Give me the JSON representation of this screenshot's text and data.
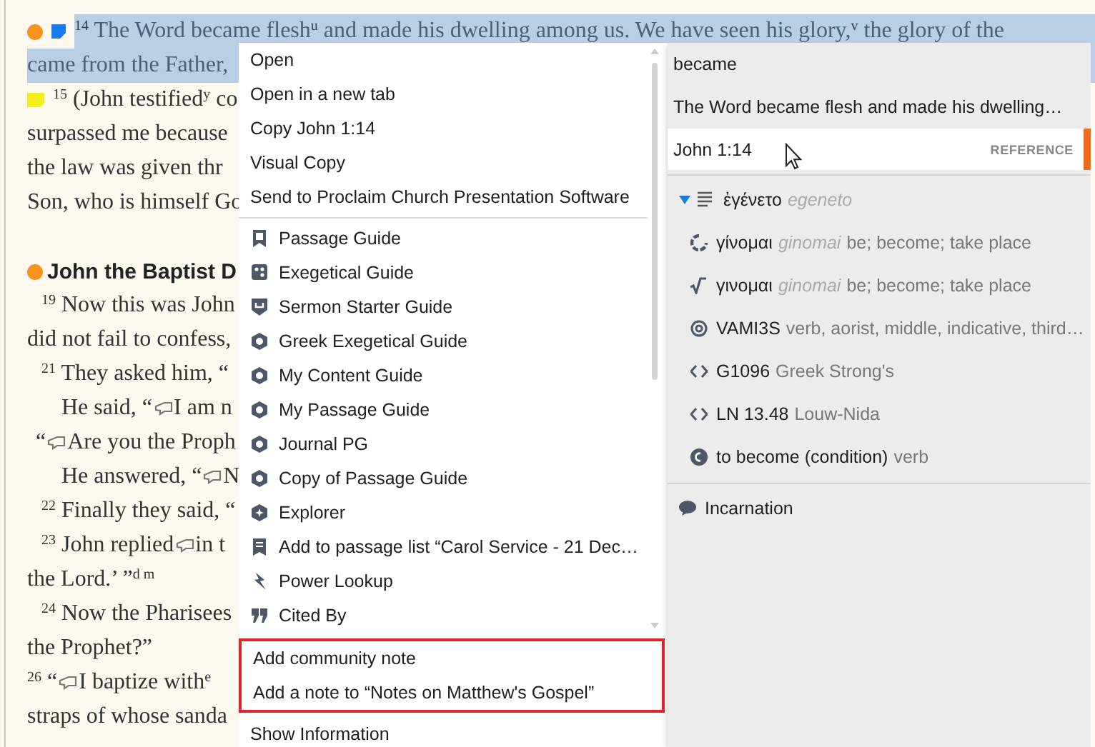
{
  "passage": {
    "lines": [
      {
        "kind": "flush",
        "highlighted": true,
        "bookmarked": true,
        "noted": true,
        "marked": false,
        "parts": [
          {
            "kind": "text",
            "text": "$^{14}$ The Word became flesh$^{u}$ and made his dwelling among us. We have seen his glory,$^{v}$ the glory of the"
          }
        ]
      },
      {
        "kind": "flush",
        "highlighted": true,
        "bookmarked": false,
        "noted": false,
        "marked": false,
        "parts": [
          {
            "kind": "text",
            "text": "came from the Father,"
          }
        ]
      },
      {
        "kind": "flush",
        "highlighted": false,
        "bookmarked": false,
        "noted": false,
        "marked": true,
        "parts": [
          {
            "kind": "text",
            "text": "$^{15}$ (John testified$^{y}$ co"
          }
        ]
      },
      {
        "kind": "flush",
        "highlighted": false,
        "bookmarked": false,
        "noted": false,
        "marked": false,
        "parts": [
          {
            "kind": "text",
            "text": "surpassed me because"
          }
        ]
      },
      {
        "kind": "flush",
        "highlighted": false,
        "bookmarked": false,
        "noted": false,
        "marked": false,
        "parts": [
          {
            "kind": "text",
            "text": "the law was given thr"
          }
        ]
      },
      {
        "kind": "flush",
        "highlighted": false,
        "bookmarked": false,
        "noted": false,
        "marked": false,
        "parts": [
          {
            "kind": "text",
            "text": "Son, who is himself Go"
          }
        ]
      },
      {
        "kind": "heading",
        "highlighted": false,
        "bookmarked": true,
        "noted": false,
        "marked": false,
        "parts": [
          {
            "kind": "text",
            "text": "John the Baptist D"
          }
        ]
      },
      {
        "kind": "indent",
        "highlighted": false,
        "bookmarked": false,
        "noted": false,
        "marked": false,
        "parts": [
          {
            "kind": "text",
            "text": "$^{19}$ Now this was John"
          }
        ]
      },
      {
        "kind": "flush",
        "highlighted": false,
        "bookmarked": false,
        "noted": false,
        "marked": false,
        "parts": [
          {
            "kind": "text",
            "text": "did not fail to confess,"
          }
        ]
      },
      {
        "kind": "indent",
        "highlighted": false,
        "bookmarked": false,
        "noted": false,
        "marked": false,
        "parts": [
          {
            "kind": "text",
            "text": "$^{21}$ They asked him, “"
          }
        ]
      },
      {
        "kind": "deep",
        "highlighted": false,
        "bookmarked": false,
        "noted": false,
        "marked": false,
        "parts": [
          {
            "kind": "text",
            "text": "He said, “"
          },
          {
            "kind": "speech"
          },
          {
            "kind": "text",
            "text": "I am n"
          }
        ]
      },
      {
        "kind": "quote",
        "highlighted": false,
        "bookmarked": false,
        "noted": false,
        "marked": false,
        "parts": [
          {
            "kind": "text",
            "text": "“"
          },
          {
            "kind": "speech"
          },
          {
            "kind": "text",
            "text": "Are you the Proph"
          }
        ]
      },
      {
        "kind": "deep",
        "highlighted": false,
        "bookmarked": false,
        "noted": false,
        "marked": false,
        "parts": [
          {
            "kind": "text",
            "text": "He answered, “"
          },
          {
            "kind": "speech"
          },
          {
            "kind": "text",
            "text": "N"
          }
        ]
      },
      {
        "kind": "indent",
        "highlighted": false,
        "bookmarked": false,
        "noted": false,
        "marked": false,
        "parts": [
          {
            "kind": "text",
            "text": "$^{22}$ Finally they said, “"
          }
        ]
      },
      {
        "kind": "indent",
        "highlighted": false,
        "bookmarked": false,
        "noted": false,
        "marked": false,
        "parts": [
          {
            "kind": "text",
            "text": "$^{23}$ John replied "
          },
          {
            "kind": "speech"
          },
          {
            "kind": "text",
            "text": "in t"
          }
        ]
      },
      {
        "kind": "flush",
        "highlighted": false,
        "bookmarked": false,
        "noted": false,
        "marked": false,
        "parts": [
          {
            "kind": "text",
            "text": "the Lord.’ ”$^{d m}$"
          }
        ]
      },
      {
        "kind": "indent",
        "highlighted": false,
        "bookmarked": false,
        "noted": false,
        "marked": false,
        "parts": [
          {
            "kind": "text",
            "text": "$^{24}$ Now the Pharisees"
          }
        ]
      },
      {
        "kind": "flush",
        "highlighted": false,
        "bookmarked": false,
        "noted": false,
        "marked": false,
        "parts": [
          {
            "kind": "text",
            "text": "the Prophet?”"
          }
        ]
      },
      {
        "kind": "flush",
        "highlighted": false,
        "bookmarked": false,
        "noted": false,
        "marked": false,
        "parts": [
          {
            "kind": "text",
            "text": "$^{26}$ “"
          },
          {
            "kind": "speech"
          },
          {
            "kind": "text",
            "text": "I baptize with$^{e}$"
          }
        ]
      },
      {
        "kind": "flush",
        "highlighted": false,
        "bookmarked": false,
        "noted": false,
        "marked": false,
        "parts": [
          {
            "kind": "text",
            "text": "straps of whose sanda"
          }
        ]
      }
    ]
  },
  "context_menu": {
    "scroll_groups": [
      [
        {
          "label": "Open"
        },
        {
          "label": "Open in a new tab"
        },
        {
          "label": "Copy John 1:14"
        },
        {
          "label": "Visual Copy"
        },
        {
          "label": "Send to Proclaim Church Presentation Software"
        }
      ],
      [
        {
          "label": "Passage Guide"
        },
        {
          "label": "Exegetical Guide"
        },
        {
          "label": "Sermon Starter Guide"
        },
        {
          "label": "Greek Exegetical Guide"
        },
        {
          "label": "My Content Guide"
        },
        {
          "label": "My Passage Guide"
        },
        {
          "label": "Journal PG"
        },
        {
          "label": "Copy of Passage Guide"
        },
        {
          "label": "Explorer"
        },
        {
          "label": "Add to passage list “Carol Service - 21 Dec…"
        },
        {
          "label": "Power Lookup"
        },
        {
          "label": "Cited By"
        }
      ]
    ],
    "extra_groups": [
      {
        "outlined": true,
        "items": [
          {
            "label": "Add community note"
          },
          {
            "label": "Add a note to “Notes on Matthew's Gospel”"
          }
        ]
      },
      {
        "outlined": false,
        "items": [
          {
            "label": "Show Information"
          }
        ]
      }
    ]
  },
  "info_panel": {
    "sections": [
      [
        {
          "text": "became",
          "selected": false
        },
        {
          "text": "The Word became flesh and made his dwelling…",
          "selected": false
        },
        {
          "text": "John 1:14",
          "tag": "REFERENCE",
          "selected": true
        }
      ],
      [
        {
          "text": "ἐγένετο",
          "translit": "egeneto",
          "expanded": true,
          "children": [
            {
              "text": "γίνομαι",
              "translit": "ginomai",
              "gloss": "be; become; take place"
            },
            {
              "text": "γινομαι",
              "translit": "ginomai",
              "gloss": "be; become; take place"
            },
            {
              "text": "VAMI3S",
              "gloss": "verb, aorist, middle, indicative, third…"
            },
            {
              "text": "G1096",
              "gloss": "Greek Strong's"
            },
            {
              "text": "LN 13.48",
              "gloss": "Louw-Nida"
            },
            {
              "text": "to become (condition)",
              "gloss": "verb"
            }
          ]
        }
      ],
      [
        {
          "text": "Incarnation"
        }
      ]
    ]
  }
}
